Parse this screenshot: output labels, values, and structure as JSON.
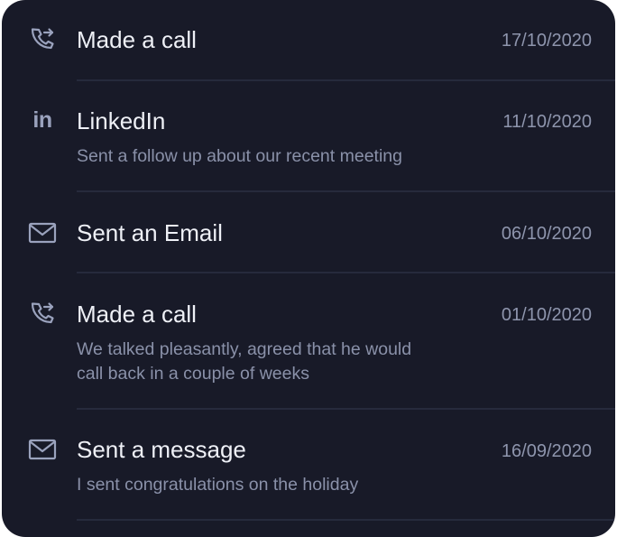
{
  "activities": [
    {
      "icon": "phone-forward-icon",
      "title": "Made a call",
      "date": "17/10/2020",
      "description": ""
    },
    {
      "icon": "linkedin-icon",
      "icon_text": "in",
      "title": "LinkedIn",
      "date": "11/10/2020",
      "description": "Sent a follow up about our recent meeting"
    },
    {
      "icon": "mail-icon",
      "title": "Sent an Email",
      "date": "06/10/2020",
      "description": ""
    },
    {
      "icon": "phone-forward-icon",
      "title": "Made a call",
      "date": "01/10/2020",
      "description": "We talked pleasantly, agreed that he would call back in a couple of weeks"
    },
    {
      "icon": "mail-icon",
      "title": "Sent a message",
      "date": "16/09/2020",
      "description": "I sent congratulations on the holiday"
    }
  ],
  "colors": {
    "background": "#181a28",
    "title": "#eef0f6",
    "secondary": "#8e95ad",
    "icon": "#9aa2bd",
    "divider": "#262a3c"
  }
}
